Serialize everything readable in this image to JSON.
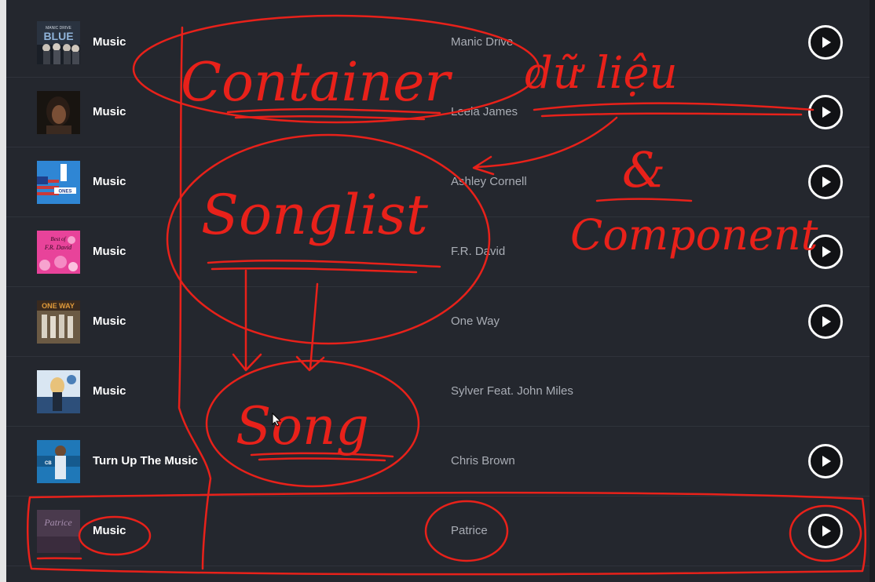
{
  "songs": [
    {
      "title": "Music",
      "artist": "Manic Drive",
      "cover": "cover-blue-band",
      "cover_text": "MANIC DRIVE BLUE"
    },
    {
      "title": "Music",
      "artist": "Leela James",
      "cover": "cover-portrait"
    },
    {
      "title": "Music",
      "artist": "Ashley Cornell",
      "cover": "cover-number1-ones"
    },
    {
      "title": "Music",
      "artist": "F.R. David",
      "cover": "cover-best-of-fr-david",
      "cover_text": "Best of F.R. David"
    },
    {
      "title": "Music",
      "artist": "One Way",
      "cover": "cover-one-way",
      "cover_text": "ONE WAY"
    },
    {
      "title": "Music",
      "artist": "Sylver Feat. John Miles",
      "cover": "cover-sylver"
    },
    {
      "title": "Turn Up The Music",
      "artist": "Chris Brown",
      "cover": "cover-chris-brown"
    },
    {
      "title": "Music",
      "artist": "Patrice",
      "cover": "cover-patrice",
      "cover_text": "Patrice"
    }
  ],
  "annotations": {
    "container": "Container",
    "du_lieu": "dữ liệu",
    "and": "&",
    "component": "Component",
    "songlist": "Songlist",
    "song": "Song"
  },
  "colors": {
    "background": "#24272e",
    "annotation_ink": "#e8211a",
    "title_text": "#ffffff",
    "artist_text": "#a9adb5"
  }
}
